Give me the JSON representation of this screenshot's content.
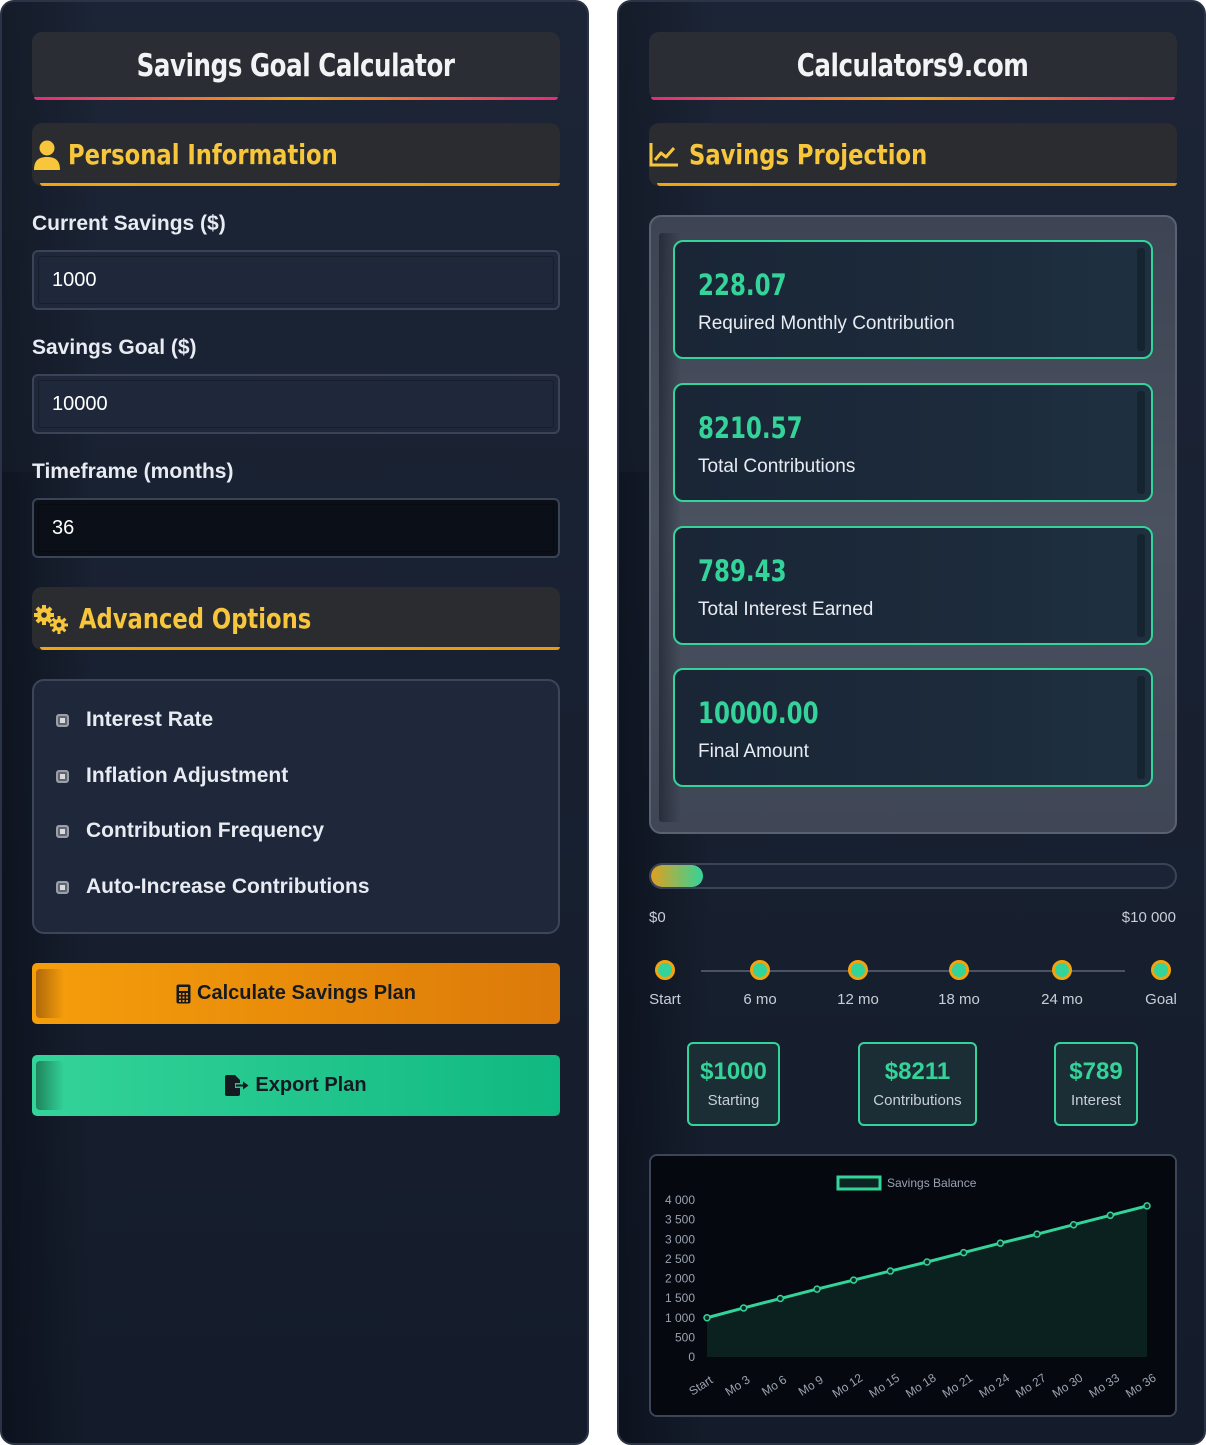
{
  "left": {
    "title": "Savings Goal Calculator",
    "personal_section": "Personal Information",
    "fields": {
      "current_savings": {
        "label": "Current Savings ($)",
        "value": "1000"
      },
      "savings_goal": {
        "label": "Savings Goal ($)",
        "value": "10000"
      },
      "timeframe": {
        "label": "Timeframe (months)",
        "value": "36"
      }
    },
    "advanced_section": "Advanced Options",
    "options": [
      "Interest Rate",
      "Inflation Adjustment",
      "Contribution Frequency",
      "Auto-Increase Contributions"
    ],
    "calculate_label": "Calculate Savings Plan",
    "export_label": "Export Plan"
  },
  "right": {
    "title": "Calculators9.com",
    "projection_section": "Savings Projection",
    "stats": [
      {
        "value": "228.07",
        "label": "Required Monthly Contribution"
      },
      {
        "value": "8210.57",
        "label": "Total Contributions"
      },
      {
        "value": "789.43",
        "label": "Total Interest Earned"
      },
      {
        "value": "10000.00",
        "label": "Final Amount"
      }
    ],
    "progress": {
      "fraction": 0.1,
      "min_label": "$0",
      "max_label": "$10 000"
    },
    "milestones": [
      "Start",
      "6 mo",
      "12 mo",
      "18 mo",
      "24 mo",
      "Goal"
    ],
    "summary": [
      {
        "value": "$1000",
        "label": "Starting"
      },
      {
        "value": "$8211",
        "label": "Contributions"
      },
      {
        "value": "$789",
        "label": "Interest"
      }
    ]
  },
  "colors": {
    "accent_green": "#34d399",
    "accent_gold": "#f7c63a",
    "orange": "#f59e0b"
  },
  "icons": {
    "personal": "user-icon",
    "advanced": "gears-icon",
    "projection": "chart-line-icon",
    "calculate": "calculator-icon",
    "export": "file-export-icon"
  },
  "chart_data": {
    "type": "line",
    "series": [
      {
        "name": "Savings Balance",
        "values": [
          1000,
          1250,
          1490,
          1730,
          1960,
          2190,
          2420,
          2660,
          2900,
          3130,
          3370,
          3610,
          3850
        ]
      }
    ],
    "categories": [
      "Start",
      "Mo 3",
      "Mo 6",
      "Mo 9",
      "Mo 12",
      "Mo 15",
      "Mo 18",
      "Mo 21",
      "Mo 24",
      "Mo 27",
      "Mo 30",
      "Mo 33",
      "Mo 36"
    ],
    "ylim": [
      0,
      4000
    ],
    "yticks": [
      "0",
      "500",
      "1 000",
      "1 500",
      "2 000",
      "2 500",
      "3 000",
      "3 500",
      "4 000"
    ],
    "legend": "top-center",
    "grid": false
  }
}
